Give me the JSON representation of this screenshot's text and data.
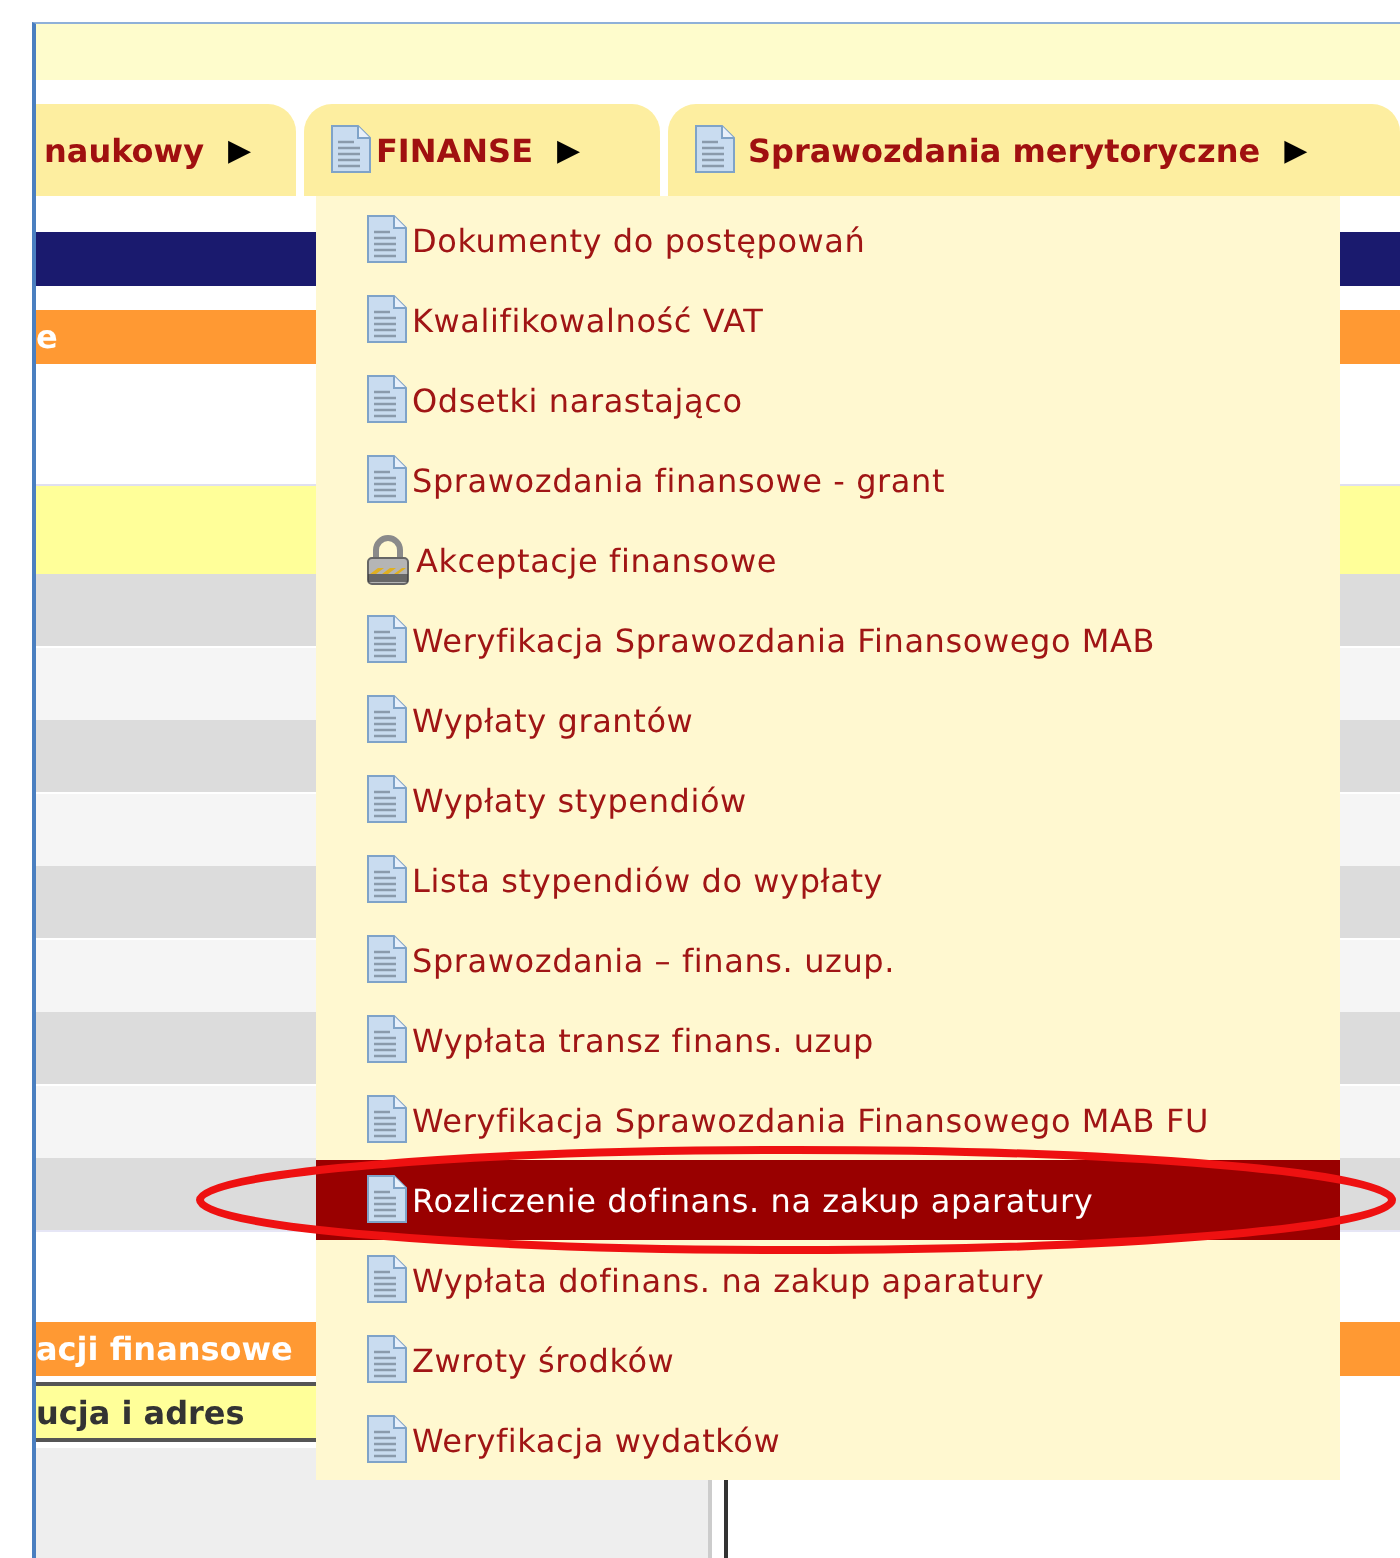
{
  "tabs": [
    {
      "label": "naukowy",
      "kind": "plain",
      "arrow": "▶"
    },
    {
      "label": "FINANSE",
      "kind": "doc",
      "arrow": "▶"
    },
    {
      "label": "Sprawozdania merytoryczne",
      "kind": "doc",
      "arrow": "▶"
    }
  ],
  "content": {
    "header_text": "e",
    "section_title": "acji finansowe",
    "field_label": "ucja i adres"
  },
  "menu": {
    "items": [
      {
        "label": "Dokumenty do postępowań",
        "kind": "doc",
        "selected": false
      },
      {
        "label": "Kwalifikowalność VAT",
        "kind": "doc",
        "selected": false
      },
      {
        "label": "Odsetki narastająco",
        "kind": "doc",
        "selected": false
      },
      {
        "label": "Sprawozdania finansowe - grant",
        "kind": "doc",
        "selected": false
      },
      {
        "label": "Akceptacje finansowe",
        "kind": "lock",
        "selected": false
      },
      {
        "label": "Weryfikacja Sprawozdania Finansowego MAB",
        "kind": "doc",
        "selected": false
      },
      {
        "label": "Wypłaty grantów",
        "kind": "doc",
        "selected": false
      },
      {
        "label": "Wypłaty stypendiów",
        "kind": "doc",
        "selected": false
      },
      {
        "label": "Lista stypendiów do wypłaty",
        "kind": "doc",
        "selected": false
      },
      {
        "label": "Sprawozdania – finans. uzup.",
        "kind": "doc",
        "selected": false
      },
      {
        "label": "Wypłata transz finans. uzup",
        "kind": "doc",
        "selected": false
      },
      {
        "label": "Weryfikacja Sprawozdania Finansowego MAB FU",
        "kind": "doc",
        "selected": false
      },
      {
        "label": "Rozliczenie dofinans. na zakup aparatury",
        "kind": "doc",
        "selected": true
      },
      {
        "label": "Wypłata dofinans. na zakup aparatury",
        "kind": "doc",
        "selected": false
      },
      {
        "label": "Zwroty środków",
        "kind": "doc",
        "selected": false
      },
      {
        "label": "Weryfikacja wydatków",
        "kind": "doc",
        "selected": false
      }
    ]
  }
}
